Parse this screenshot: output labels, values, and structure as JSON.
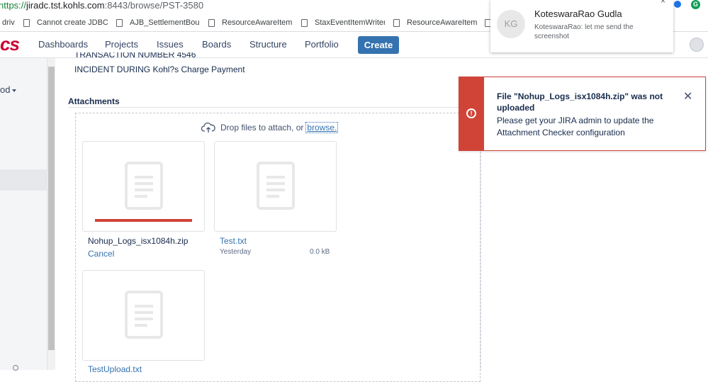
{
  "browser": {
    "url_scheme": "https://",
    "url_host": "jiradc.tst.kohls.com",
    "url_path": ":8443/browse/PST-3580",
    "bookmarks": [
      {
        "label": "driv"
      },
      {
        "label": "Cannot create JDBC dr"
      },
      {
        "label": "AJB_SettlementBound"
      },
      {
        "label": "ResourceAwareItemW"
      },
      {
        "label": "StaxEventItemWriter ("
      },
      {
        "label": "ResourceAwareItemW"
      }
    ],
    "extension_green_label": "G"
  },
  "nav": {
    "logo": "cs",
    "items": [
      "Dashboards",
      "Projects",
      "Issues",
      "Boards",
      "Structure",
      "Portfolio"
    ],
    "create_label": "Create"
  },
  "sidebar": {
    "partial_label": "od"
  },
  "issue": {
    "transaction_line": "TRANSACTION NUMBER 4546",
    "incident_line": "INCIDENT DURING Kohl?s Charge Payment"
  },
  "attachments": {
    "title": "Attachments",
    "drop_text": "Drop files to attach, or",
    "browse_label": "browse.",
    "files": [
      {
        "name": "Nohup_Logs_isx1084h.zip",
        "action": "Cancel",
        "upload_progress": 1.0
      },
      {
        "name": "Test.txt",
        "date": "Yesterday",
        "size": "0.0 kB"
      },
      {
        "name": "TestUpload.txt"
      }
    ]
  },
  "notification": {
    "initials": "KG",
    "name": "KoteswaraRao Gudla",
    "message": "KoteswaraRao: let me send the screenshot",
    "close": "×"
  },
  "error_flag": {
    "title": "File \"Nohup_Logs_isx1084h.zip\" was not uploaded",
    "body": "Please get your JIRA admin to update the Attachment Checker configuration",
    "icon": "!",
    "close": "✕",
    "color": "#d04437"
  }
}
